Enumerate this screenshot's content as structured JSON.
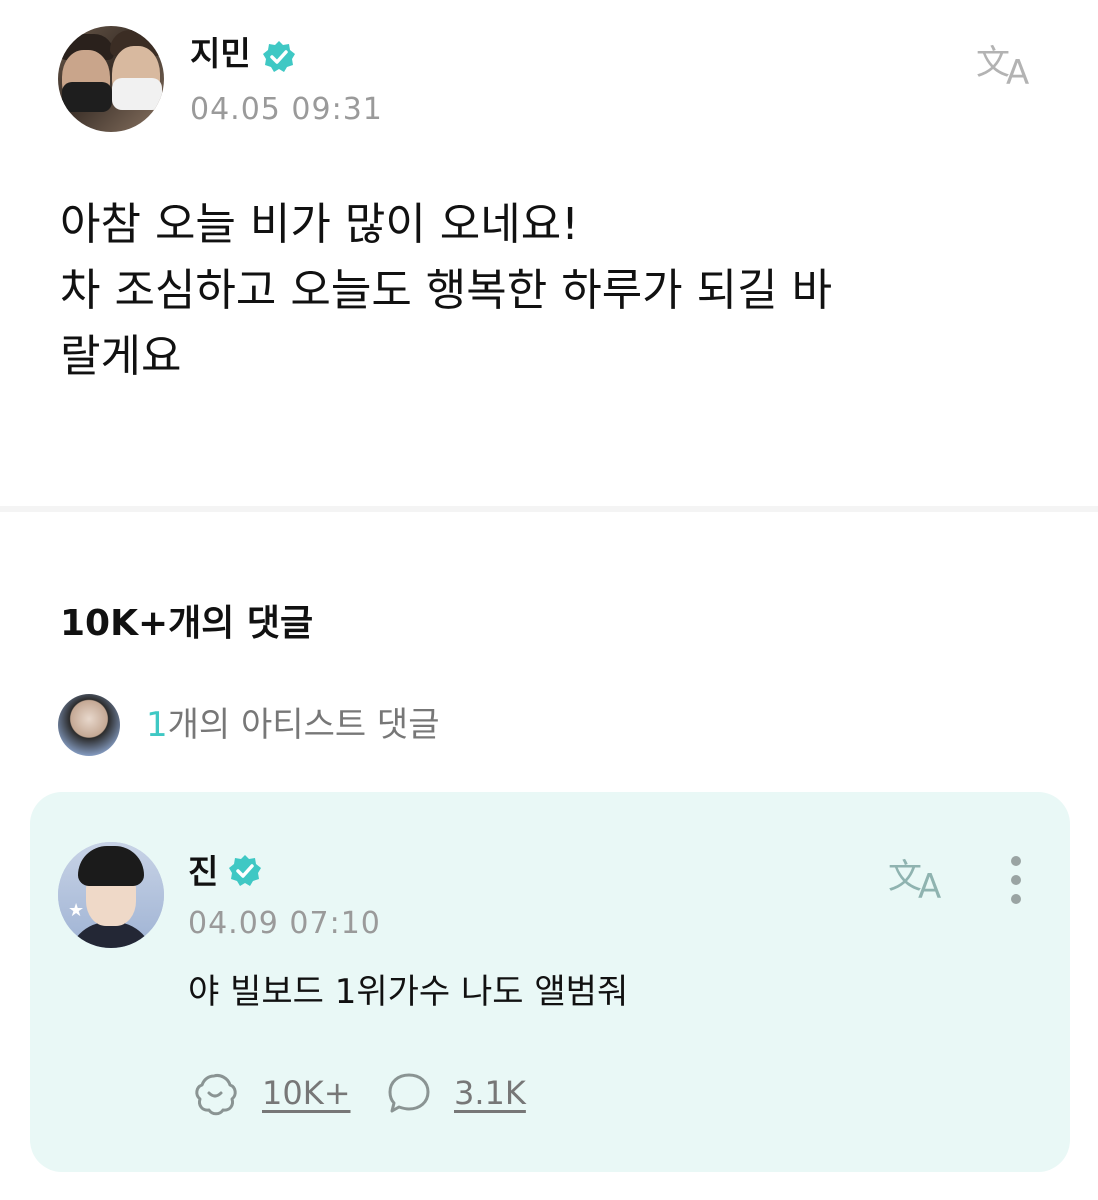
{
  "post": {
    "author": "지민",
    "time": "04.05 09:31",
    "lines": [
      "아참 오늘 비가 많이 오네요!",
      "차 조심하고 오늘도 행복한 하루가 되길 바",
      "랄게요"
    ]
  },
  "comments_header": "10K+개의 댓글",
  "artist_comments": {
    "count": "1",
    "label": "개의 아티스트 댓글"
  },
  "comment": {
    "author": "진",
    "time": "04.09 07:10",
    "text": "야 빌보드 1위가수 나도 앨범줘",
    "likes": "10K+",
    "replies": "3.1K"
  },
  "icons": {
    "verified": "verified-badge-icon",
    "translate": "translate-icon",
    "more": "more-vertical-icon",
    "like": "like-icon",
    "reply": "comment-icon"
  },
  "colors": {
    "accent": "#3fc8c4",
    "card_background": "#e9f8f6",
    "muted_text": "#9a9a9a"
  }
}
